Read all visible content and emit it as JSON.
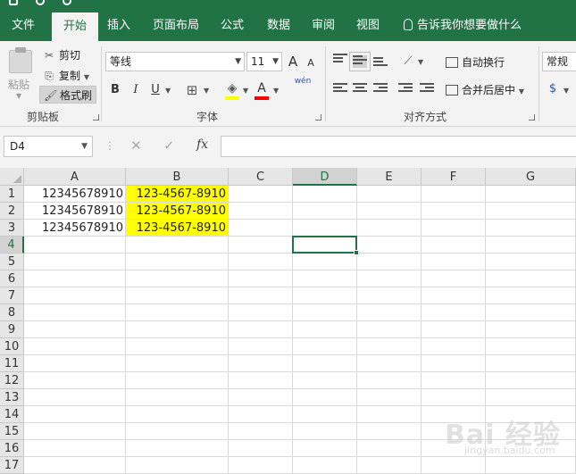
{
  "ribbon_tabs": [
    "文件",
    "开始",
    "插入",
    "页面布局",
    "公式",
    "数据",
    "审阅",
    "视图"
  ],
  "tell_me": "告诉我你想要做什么",
  "clipboard": {
    "paste": "粘贴",
    "cut": "剪切",
    "copy": "复制",
    "format_painter": "格式刷",
    "group_label": "剪贴板"
  },
  "font": {
    "name": "等线",
    "size": "11",
    "group_label": "字体",
    "bold": "B",
    "italic": "I",
    "underline": "U",
    "grow": "A",
    "shrink": "A",
    "phonetic": "wén",
    "font_color_letter": "A",
    "fill_color": "#ffff00",
    "font_color": "#ff0000"
  },
  "alignment": {
    "wrap_text": "自动换行",
    "merge_center": "合并后居中",
    "group_label": "对齐方式"
  },
  "number": {
    "format": "常规"
  },
  "formula_bar": {
    "name_box": "D4",
    "fx": "fx",
    "cancel": "✕",
    "enter": "✓",
    "content": ""
  },
  "columns": [
    "A",
    "B",
    "C",
    "D",
    "E",
    "F",
    "G"
  ],
  "active_column": "D",
  "rows": [
    "1",
    "2",
    "3",
    "4",
    "5",
    "6",
    "7",
    "8",
    "9",
    "10",
    "11",
    "12",
    "13",
    "14",
    "15",
    "16",
    "17"
  ],
  "active_row": "4",
  "cells": {
    "A1": "12345678910",
    "A2": "12345678910",
    "A3": "12345678910",
    "B1": "123-4567-8910",
    "B2": "123-4567-8910",
    "B3": "123-4567-8910"
  },
  "highlight_color": "#ffff00",
  "accent_color": "#217346",
  "watermark": {
    "text": "Bai 经验",
    "url": "jingyan.baidu.com"
  }
}
